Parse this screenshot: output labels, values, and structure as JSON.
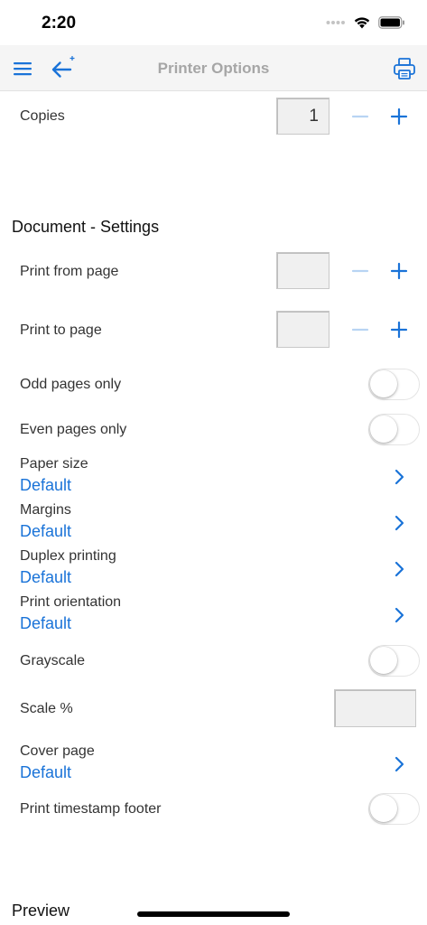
{
  "status_bar": {
    "time": "2:20"
  },
  "nav": {
    "title": "Printer Options"
  },
  "copies": {
    "label": "Copies",
    "value": "1"
  },
  "document_settings": {
    "title": "Document - Settings",
    "print_from_page": {
      "label": "Print from page",
      "value": ""
    },
    "print_to_page": {
      "label": "Print to page",
      "value": ""
    },
    "odd_pages_only": {
      "label": "Odd pages only",
      "on": false
    },
    "even_pages_only": {
      "label": "Even pages only",
      "on": false
    },
    "paper_size": {
      "label": "Paper size",
      "value": "Default"
    },
    "margins": {
      "label": "Margins",
      "value": "Default"
    },
    "duplex_printing": {
      "label": "Duplex printing",
      "value": "Default"
    },
    "print_orientation": {
      "label": "Print orientation",
      "value": "Default"
    },
    "grayscale": {
      "label": "Grayscale",
      "on": false
    },
    "scale": {
      "label": "Scale %",
      "value": ""
    },
    "cover_page": {
      "label": "Cover page",
      "value": "Default"
    },
    "print_timestamp_footer": {
      "label": "Print timestamp footer",
      "on": false
    }
  },
  "preview": {
    "title": "Preview"
  },
  "colors": {
    "accent": "#1a73d8",
    "accent_disabled": "#b8d4f3",
    "nav_title": "#a6a6a6"
  },
  "icons": {
    "menu": "hamburger-menu-icon",
    "back": "back-arrow-icon",
    "print": "printer-icon",
    "minus": "minus-icon",
    "plus": "plus-icon",
    "chevron": "chevron-right-icon"
  }
}
